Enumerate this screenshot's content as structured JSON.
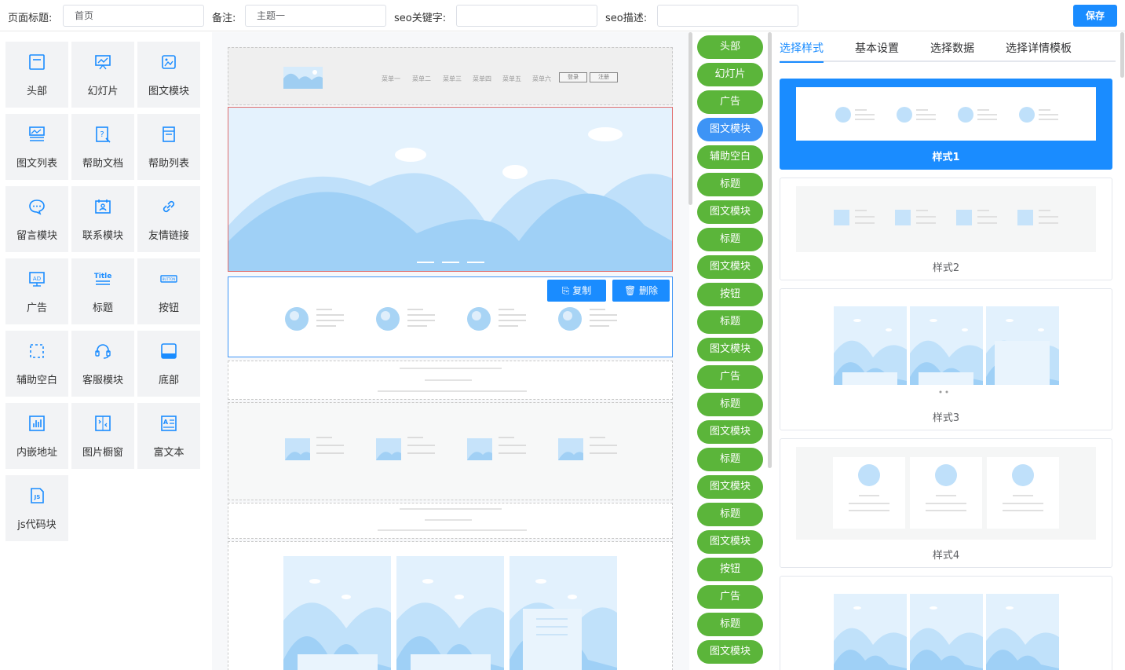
{
  "topbar": {
    "page_title_label": "页面标题:",
    "page_title_value": "首页",
    "remark_label": "备注:",
    "remark_value": "主题一",
    "seo_keywords_label": "seo关键字:",
    "seo_keywords_value": "",
    "seo_desc_label": "seo描述:",
    "seo_desc_value": "",
    "save_label": "保存"
  },
  "palette": {
    "items": [
      {
        "label": "头部",
        "icon": "header-icon"
      },
      {
        "label": "幻灯片",
        "icon": "slideshow-icon"
      },
      {
        "label": "图文模块",
        "icon": "image-icon"
      },
      {
        "label": "图文列表",
        "icon": "image-list-icon"
      },
      {
        "label": "帮助文档",
        "icon": "help-doc-icon"
      },
      {
        "label": "帮助列表",
        "icon": "help-list-icon"
      },
      {
        "label": "留言模块",
        "icon": "message-icon"
      },
      {
        "label": "联系模块",
        "icon": "contact-icon"
      },
      {
        "label": "友情链接",
        "icon": "link-icon"
      },
      {
        "label": "广告",
        "icon": "ad-icon"
      },
      {
        "label": "标题",
        "icon": "title-icon"
      },
      {
        "label": "按钮",
        "icon": "button-icon"
      },
      {
        "label": "辅助空白",
        "icon": "blank-icon"
      },
      {
        "label": "客服模块",
        "icon": "headset-icon"
      },
      {
        "label": "底部",
        "icon": "footer-icon"
      },
      {
        "label": "内嵌地址",
        "icon": "embed-icon"
      },
      {
        "label": "图片橱窗",
        "icon": "gallery-icon"
      },
      {
        "label": "富文本",
        "icon": "richtext-icon"
      },
      {
        "label": "js代码块",
        "icon": "js-icon"
      }
    ]
  },
  "canvas": {
    "menu_items": [
      "菜单一",
      "菜单二",
      "菜单三",
      "菜单四",
      "菜单五",
      "菜单六"
    ],
    "login_label": "登录",
    "register_label": "注册",
    "copy_label": "复制",
    "delete_label": "删除"
  },
  "tags": [
    {
      "label": "头部",
      "active": false
    },
    {
      "label": "幻灯片",
      "active": false
    },
    {
      "label": "广告",
      "active": false
    },
    {
      "label": "图文模块",
      "active": true
    },
    {
      "label": "辅助空白",
      "active": false
    },
    {
      "label": "标题",
      "active": false
    },
    {
      "label": "图文模块",
      "active": false
    },
    {
      "label": "标题",
      "active": false
    },
    {
      "label": "图文模块",
      "active": false
    },
    {
      "label": "按钮",
      "active": false
    },
    {
      "label": "标题",
      "active": false
    },
    {
      "label": "图文模块",
      "active": false
    },
    {
      "label": "广告",
      "active": false
    },
    {
      "label": "标题",
      "active": false
    },
    {
      "label": "图文模块",
      "active": false
    },
    {
      "label": "标题",
      "active": false
    },
    {
      "label": "图文模块",
      "active": false
    },
    {
      "label": "标题",
      "active": false
    },
    {
      "label": "图文模块",
      "active": false
    },
    {
      "label": "按钮",
      "active": false
    },
    {
      "label": "广告",
      "active": false
    },
    {
      "label": "标题",
      "active": false
    },
    {
      "label": "图文模块",
      "active": false
    }
  ],
  "right_panel": {
    "tabs": [
      "选择样式",
      "基本设置",
      "选择数据",
      "选择详情模板"
    ],
    "active_tab": "选择样式",
    "styles": [
      {
        "label": "样式1",
        "selected": true
      },
      {
        "label": "样式2",
        "selected": false
      },
      {
        "label": "样式3",
        "selected": false
      },
      {
        "label": "样式4",
        "selected": false
      },
      {
        "label": "",
        "selected": false
      }
    ]
  },
  "colors": {
    "accent": "#1a8cff",
    "tag_green": "#5bb53a",
    "tag_active": "#3d94f6",
    "palette_bg": "#f2f3f5",
    "illustration_blue": "#a8d4f5"
  }
}
